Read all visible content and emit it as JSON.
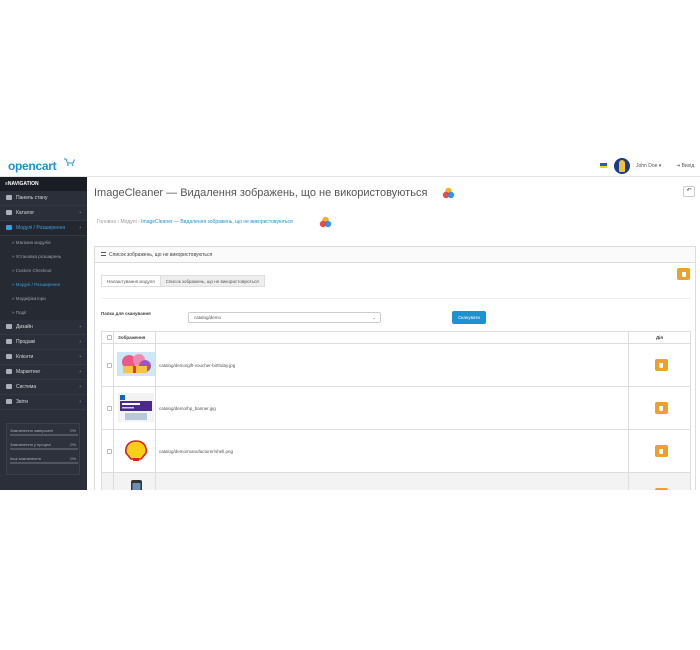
{
  "header": {
    "logo": "opencart",
    "user_name": "John Doe",
    "logout_label": "Вихід"
  },
  "sidebar": {
    "nav_title": "NAVIGATION",
    "items": [
      {
        "label": "Панель стану",
        "icon": "dashboard-icon",
        "arrow": ""
      },
      {
        "label": "Каталог",
        "icon": "tag-icon",
        "arrow": "›"
      },
      {
        "label": "Модулі / Розширення",
        "icon": "puzzle-icon",
        "arrow": "›"
      }
    ],
    "subitems": [
      {
        "label": "Магазин модулів"
      },
      {
        "label": "Установка розширень"
      },
      {
        "label": "Custom Checkout"
      },
      {
        "label": "Модулі / Розширення"
      },
      {
        "label": "Модифікатори"
      },
      {
        "label": "Події"
      }
    ],
    "items2": [
      {
        "label": "Дизайн",
        "icon": "monitor-icon",
        "arrow": "›"
      },
      {
        "label": "Продажі",
        "icon": "cart-icon",
        "arrow": "›"
      },
      {
        "label": "Клієнти",
        "icon": "user-icon",
        "arrow": "›"
      },
      {
        "label": "Маркетинг",
        "icon": "share-icon",
        "arrow": "›"
      },
      {
        "label": "Система",
        "icon": "cog-icon",
        "arrow": "›"
      },
      {
        "label": "Звіти",
        "icon": "chart-icon",
        "arrow": "›"
      }
    ],
    "stats": [
      {
        "label": "Замовлення завершені",
        "pct": "0%",
        "value": 0
      },
      {
        "label": "Замовлення у процесі",
        "pct": "0%",
        "value": 0
      },
      {
        "label": "Інші замовлення",
        "pct": "0%",
        "value": 0
      }
    ]
  },
  "page": {
    "title": "ImageCleaner — Видалення зображень, що не використовуються",
    "breadcrumbs": [
      "Головна",
      "Модулі",
      "ImageCleaner — Видалення зображень, що не використовуються"
    ],
    "crumb_sep": "›",
    "panel_title": "Список зображень, що не використовуються",
    "tabs": [
      "Налаштування модуля",
      "Список зображень, що не використовуються"
    ],
    "scan_label": "Папка для сканування",
    "scan_folder": "catalog/demo",
    "scan_button": "Сканувати",
    "table": {
      "headers": [
        "",
        "Зображення",
        "",
        "Дія"
      ],
      "rows": [
        {
          "path": "catalog/demo/gift-voucher-birthday.jpg",
          "thumb": "gift"
        },
        {
          "path": "catalog/demo/hp_banner.jpg",
          "thumb": "hp"
        },
        {
          "path": "catalog/demo/manufacturer/shell.png",
          "thumb": "shell"
        },
        {
          "path": "",
          "thumb": "phone"
        }
      ]
    }
  },
  "colors": {
    "brand": "#1e91cf",
    "warning": "#f0a028",
    "sidebar": "#2b2f39"
  }
}
